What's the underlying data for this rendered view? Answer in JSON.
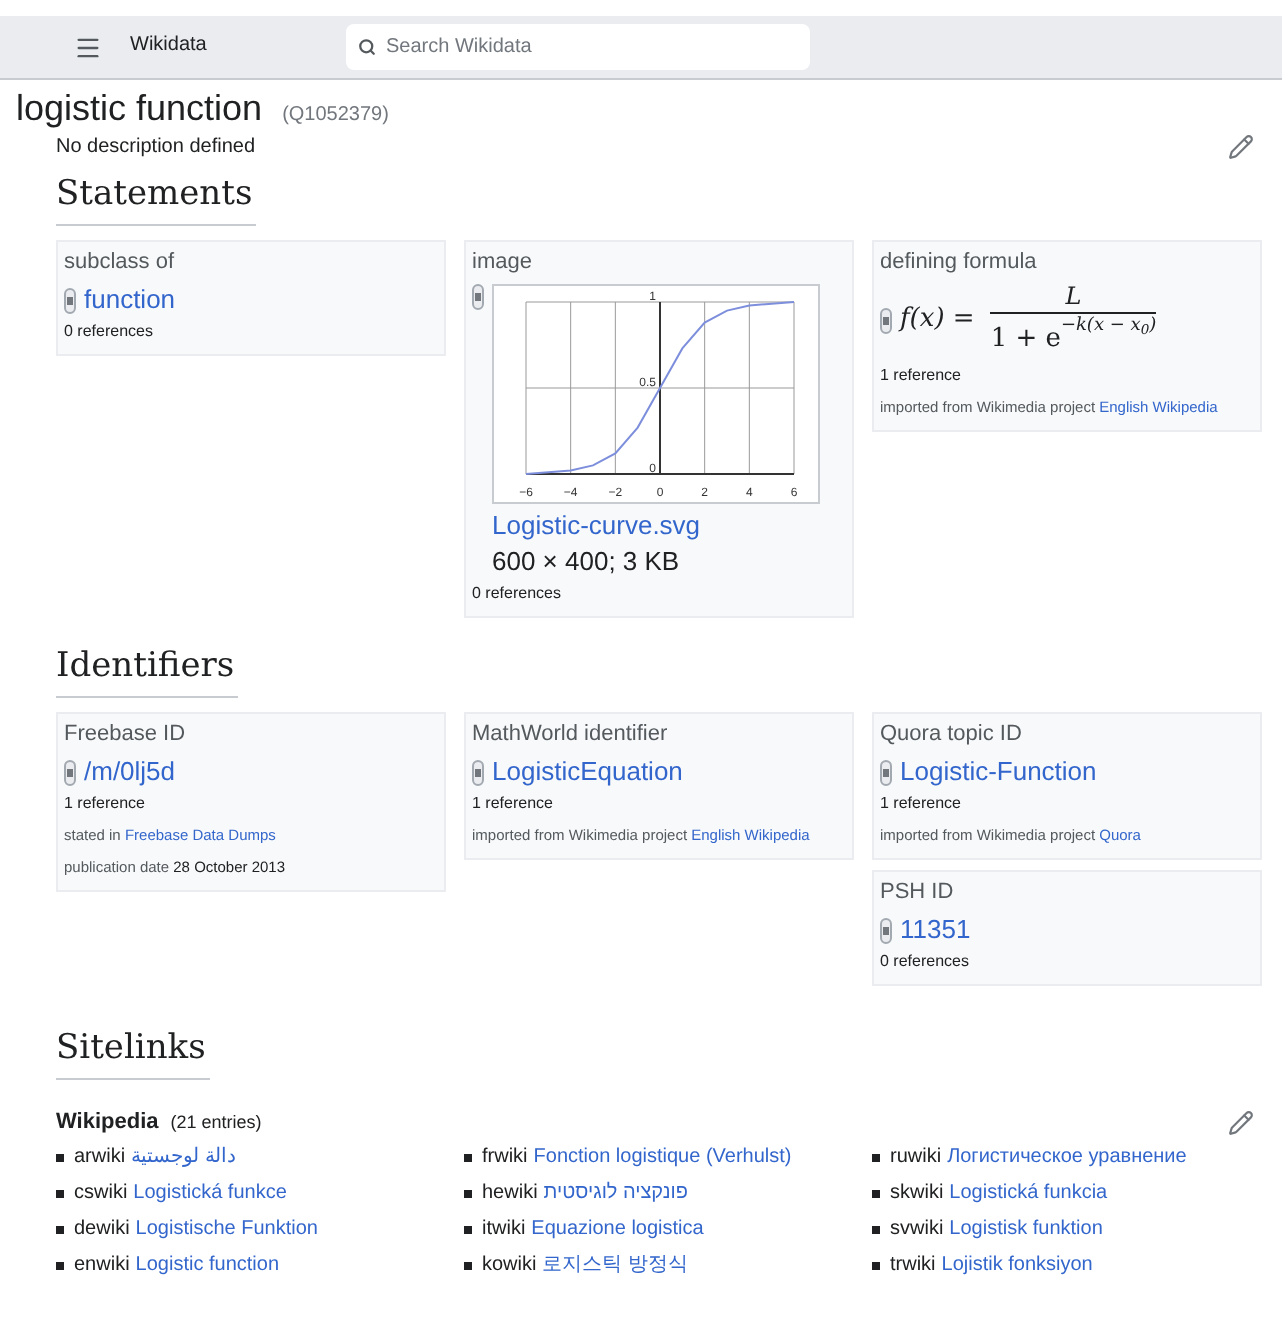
{
  "header": {
    "site_name": "Wikidata",
    "search": {
      "placeholder": "Search Wikidata"
    }
  },
  "item": {
    "label": "logistic function",
    "id": "(Q1052379)",
    "description": "No description defined"
  },
  "statements": {
    "heading": "Statements",
    "columns": [
      [
        {
          "property": "subclass of",
          "kind": "item",
          "value": "function",
          "references_count": "0 references"
        }
      ],
      [
        {
          "property": "image",
          "kind": "image",
          "value": "Logistic-curve.svg",
          "meta": "600 × 400; 3 KB",
          "references_count": "0 references",
          "chart_data": {
            "type": "line",
            "grid": true,
            "x": [
              -6,
              -5,
              -4,
              -3,
              -2,
              -1,
              0,
              1,
              2,
              3,
              4,
              5,
              6
            ],
            "series": [
              {
                "color": "#7d8fdc",
                "values": [
                  0,
                  0.01,
                  0.02,
                  0.05,
                  0.12,
                  0.27,
                  0.5,
                  0.73,
                  0.88,
                  0.95,
                  0.98,
                  0.99,
                  1
                ]
              }
            ],
            "xlim": [
              -6,
              6
            ],
            "ylim": [
              0,
              1
            ],
            "xticks": [
              {
                "value": -6,
                "label": "−6"
              },
              {
                "value": -4,
                "label": "−4"
              },
              {
                "value": -2,
                "label": "−2"
              },
              {
                "value": 0,
                "label": "0"
              },
              {
                "value": 2,
                "label": "2"
              },
              {
                "value": 4,
                "label": "4"
              },
              {
                "value": 6,
                "label": "6"
              }
            ],
            "yticks": [
              0,
              0.5,
              1
            ]
          }
        }
      ],
      [
        {
          "property": "defining formula",
          "kind": "formula",
          "formula": {
            "lhs": "f(x) =",
            "numerator": "L",
            "denominator": "1 + e",
            "exponent": "−k(x − x$_{0}$)"
          },
          "references_count": "1 reference",
          "references": [
            {
              "kind": "link",
              "label": "imported from Wikimedia project",
              "value": "English Wikipedia"
            }
          ]
        }
      ]
    ]
  },
  "identifiers": {
    "heading": "Identifiers",
    "columns": [
      [
        {
          "property": "Freebase ID",
          "kind": "external",
          "value": "/m/0lj5d",
          "references_count": "1 reference",
          "references": [
            {
              "kind": "link",
              "label": "stated in",
              "value": "Freebase Data Dumps"
            },
            {
              "kind": "text",
              "label": "publication date",
              "value": "28 October 2013"
            }
          ]
        }
      ],
      [
        {
          "property": "MathWorld identifier",
          "kind": "external",
          "value": "LogisticEquation",
          "references_count": "1 reference",
          "references": [
            {
              "kind": "link",
              "label": "imported from Wikimedia project",
              "value": "English Wikipedia"
            }
          ]
        }
      ],
      [
        {
          "property": "Quora topic ID",
          "kind": "external",
          "value": "Logistic-Function",
          "references_count": "1 reference",
          "references": [
            {
              "kind": "link",
              "label": "imported from Wikimedia project",
              "value": "Quora"
            }
          ]
        },
        {
          "property": "PSH ID",
          "kind": "external",
          "value": "11351",
          "references_count": "0 references"
        }
      ]
    ]
  },
  "sitelinks": {
    "heading": "Sitelinks",
    "group": {
      "title": "Wikipedia",
      "count": "(21 entries)",
      "columns": [
        [
          {
            "site": "arwiki",
            "title": "دالة لوجستية"
          },
          {
            "site": "cswiki",
            "title": "Logistická funkce"
          },
          {
            "site": "dewiki",
            "title": "Logistische Funktion"
          },
          {
            "site": "enwiki",
            "title": "Logistic function"
          }
        ],
        [
          {
            "site": "frwiki",
            "title": "Fonction logistique (Verhulst)"
          },
          {
            "site": "hewiki",
            "title": "פונקציה לוגיסטית"
          },
          {
            "site": "itwiki",
            "title": "Equazione logistica"
          },
          {
            "site": "kowiki",
            "title": "로지스틱 방정식"
          }
        ],
        [
          {
            "site": "ruwiki",
            "title": "Логистическое уравнение"
          },
          {
            "site": "skwiki",
            "title": "Logistická funkcia"
          },
          {
            "site": "svwiki",
            "title": "Logistisk funktion"
          },
          {
            "site": "trwiki",
            "title": "Lojistik fonksiyon"
          }
        ]
      ]
    }
  }
}
